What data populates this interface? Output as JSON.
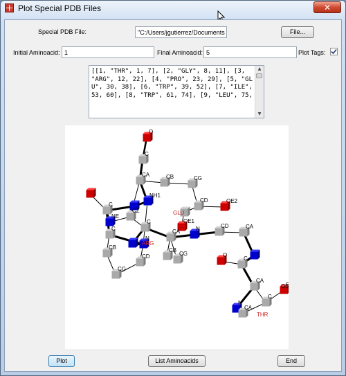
{
  "window": {
    "title": "Plot Special PDB Files",
    "close_glyph": "✕"
  },
  "form": {
    "file_label": "Special PDB File:",
    "file_value": "\"C:/Users/jgutierrez/Documents",
    "file_button": "File...",
    "initial_label": "Initial Aminoacid:",
    "initial_value": "1",
    "final_label": "Final Aminoacid:",
    "final_value": "5",
    "plot_tags_label": "Plot Tags:",
    "plot_tags_checked": true
  },
  "output_text": "[[1, \"THR\", 1, 7], [2, \"GLY\", 8, 11], [3, \"ARG\", 12, 22], [4, \"PRO\", 23, 29], [5, \"GLU\", 30, 38], [6, \"TRP\", 39, 52], [7, \"ILE\", 53, 60], [8, \"TRP\", 61, 74], [9, \"LEU\", 75,",
  "buttons": {
    "plot": "Plot",
    "list": "List Aminoacids",
    "end": "End"
  },
  "colors": {
    "carbon": "#a9a9a9",
    "nitrogen": "#0000cc",
    "oxygen": "#cc0000",
    "residue_tag": "#cc2222"
  },
  "molecule": {
    "atom_labels": [
      "O",
      "C",
      "CA",
      "CB",
      "CG",
      "NH1",
      "C",
      "NE",
      "CZ",
      "GLU",
      "CD",
      "OE2",
      "OE1",
      "C",
      "CA",
      "N",
      "CD",
      "N",
      "C",
      "ARG",
      "CD",
      "CB",
      "CG",
      "CB",
      "CG",
      "CA",
      "O",
      "C",
      "CA",
      "N",
      "O",
      "C",
      "CA",
      "N",
      "OG1",
      "CB",
      "CG2",
      "THR"
    ]
  }
}
